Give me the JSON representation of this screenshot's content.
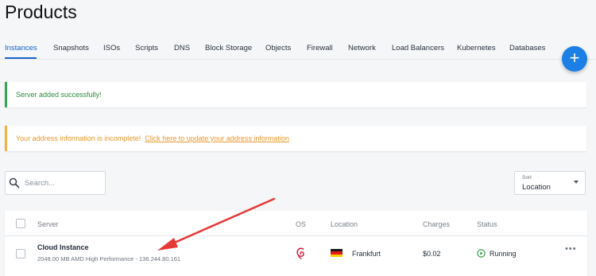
{
  "page": {
    "title": "Products"
  },
  "tabs": [
    {
      "label": "Instances",
      "active": true
    },
    {
      "label": "Snapshots"
    },
    {
      "label": "ISOs"
    },
    {
      "label": "Scripts"
    },
    {
      "label": "DNS"
    },
    {
      "label": "Block Storage"
    },
    {
      "label": "Objects"
    },
    {
      "label": "Firewall"
    },
    {
      "label": "Network"
    },
    {
      "label": "Load Balancers"
    },
    {
      "label": "Kubernetes"
    },
    {
      "label": "Databases"
    }
  ],
  "fab": {
    "symbol": "+",
    "icon": "plus-icon"
  },
  "alerts": {
    "success": {
      "text": "Server added successfully!",
      "color": "#34a853"
    },
    "warning": {
      "text": "Your address information is incomplete!",
      "link": "Click here to update your address information",
      "color": "#f4b042"
    }
  },
  "search": {
    "placeholder": "Search...",
    "value": "",
    "icon": "search-icon"
  },
  "sort": {
    "label": "Sort",
    "value": "Location"
  },
  "table": {
    "headers": {
      "server": "Server",
      "os": "OS",
      "location": "Location",
      "charges": "Charges",
      "status": "Status"
    },
    "rows": [
      {
        "name": "Cloud Instance",
        "description": "2048.00 MB AMD High Performance - 136.244.80.161",
        "os_icon": "debian-icon",
        "flag_icon": "germany-flag-icon",
        "location": "Frankfurt",
        "charges": "$0.02",
        "status": "Running",
        "status_icon": "play-circle-icon",
        "more": "•••"
      }
    ]
  },
  "colors": {
    "accent": "#1a64c8",
    "fab": "#1b7fe6",
    "arrow": "#e53935",
    "running": "#2e9e44"
  }
}
